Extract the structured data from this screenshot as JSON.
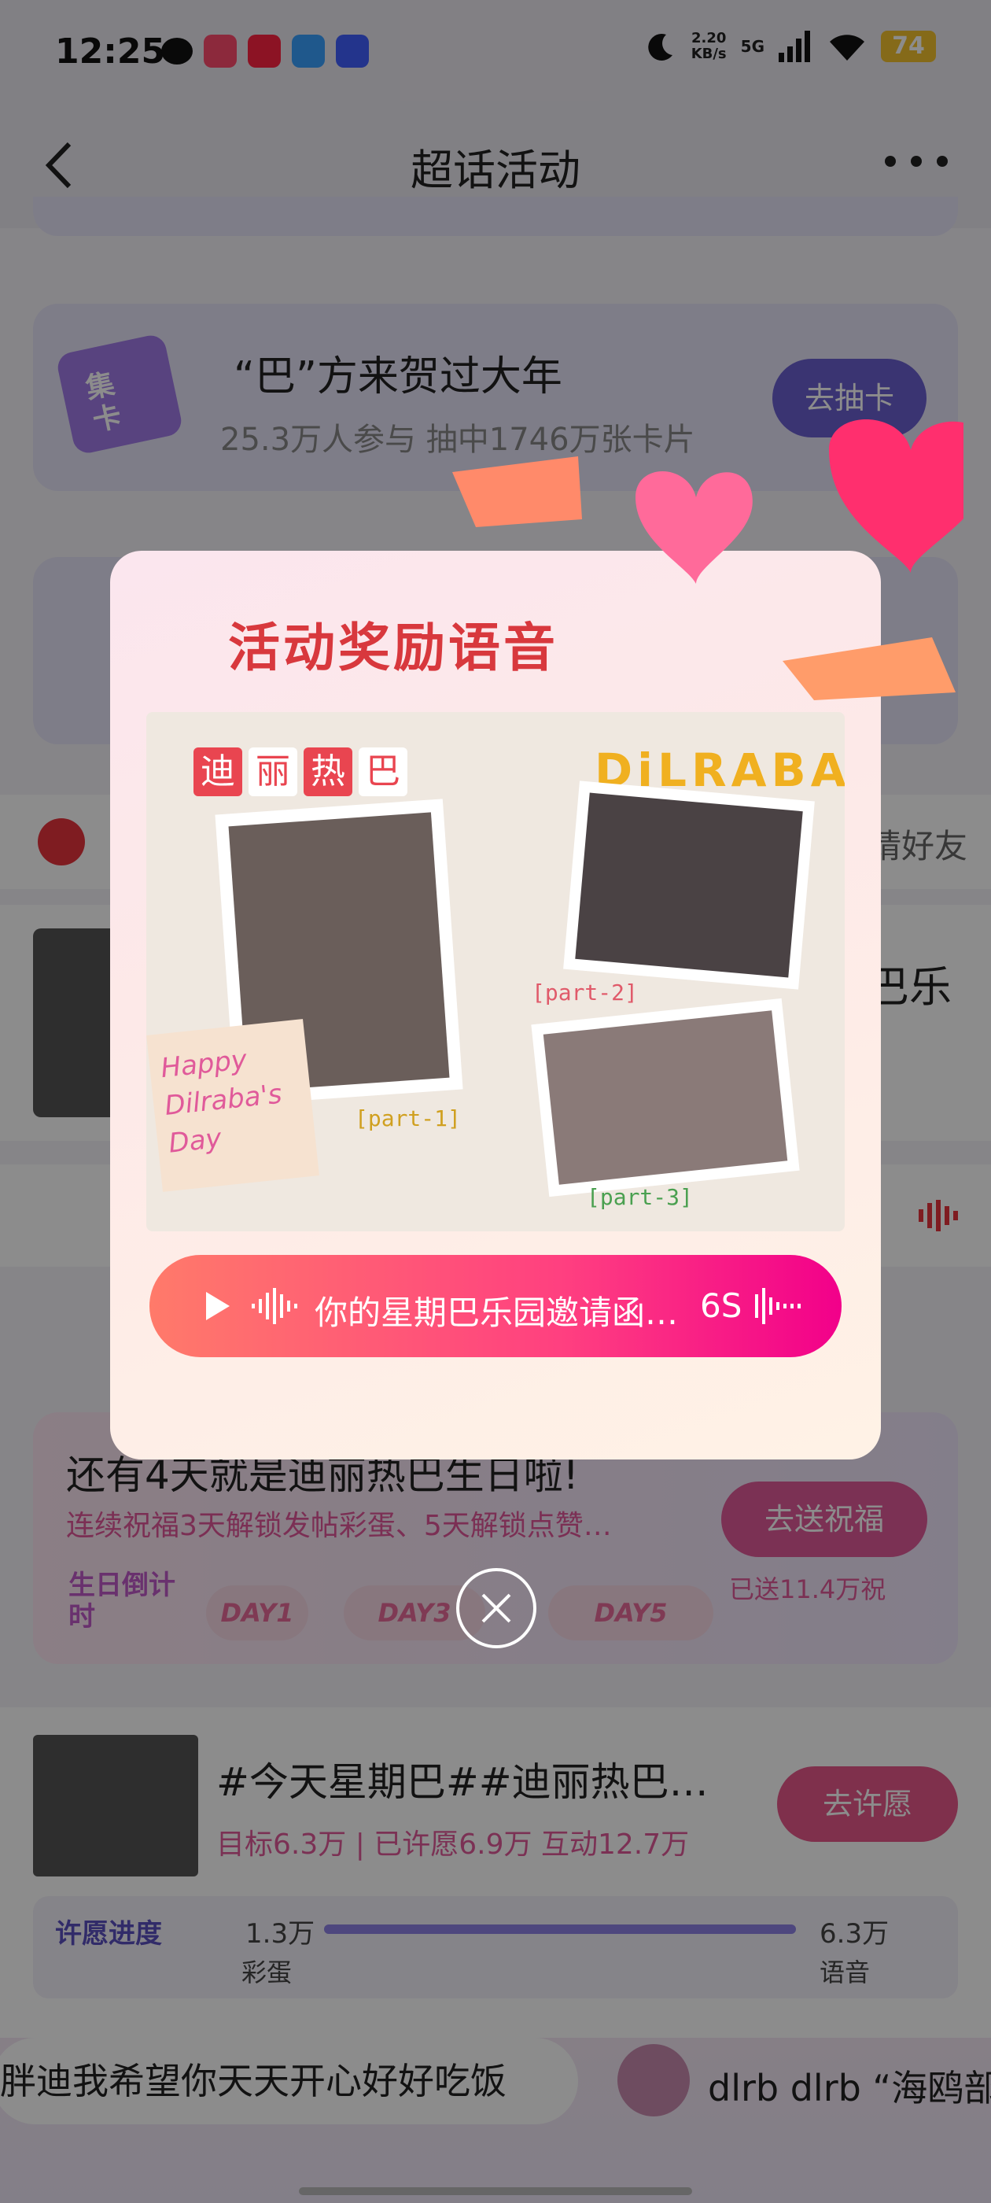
{
  "status_bar": {
    "time": "12:25",
    "net_speed": "2.20",
    "net_unit": "KB/s",
    "net_type": "5G",
    "battery": "74"
  },
  "nav": {
    "title": "超话活动"
  },
  "cards": {
    "card1": {
      "icon_text": "集卡",
      "title": "“巴”方来贺过大年",
      "subtitle": "25.3万人参与 抽中1746万张卡片",
      "button": "去抽卡"
    },
    "partial_right_1": "请好友",
    "partial_right_2": "巴乐",
    "birthday": {
      "title": "还有4天就是迪丽热巴生日啦!",
      "subtitle": "连续祝福3天解锁发帖彩蛋、5天解锁点赞…",
      "button": "去送祝福",
      "sent": "已送11.4万祝",
      "badge": "生日倒计时",
      "days": [
        "DAY1",
        "DAY3",
        "DAY5"
      ]
    },
    "wish": {
      "title": "#今天星期巴##迪丽热巴…",
      "stats": "目标6.3万 | 已许愿6.9万 互动12.7万",
      "button": "去许愿",
      "progress_label": "许愿进度",
      "start_value": "1.3万",
      "start_label": "彩蛋",
      "end_value": "6.3万",
      "end_label": "语音",
      "progress": 1.0
    },
    "ticker": {
      "left": "胖迪我希望你天天开心好好吃饭",
      "right": "dlrb dlrb “海鸥部"
    }
  },
  "modal": {
    "title": "活动奖励语音",
    "photo_labels": {
      "name_chars": [
        "迪",
        "丽",
        "热",
        "巴"
      ],
      "brand": "DiLRABA",
      "happy": "Happy",
      "dilraba_s": "Dilraba's",
      "day": "Day",
      "part1": "[part-1]",
      "part2": "[part-2]",
      "part3": "[part-3]"
    },
    "voice_text": "你的星期巴乐园邀请函…",
    "voice_duration": "6S"
  },
  "colors": {
    "accent": "#ff3f80",
    "title_red": "#d8383d",
    "purple_button": "#6b5fd0",
    "pink_button": "#e05a9a"
  }
}
